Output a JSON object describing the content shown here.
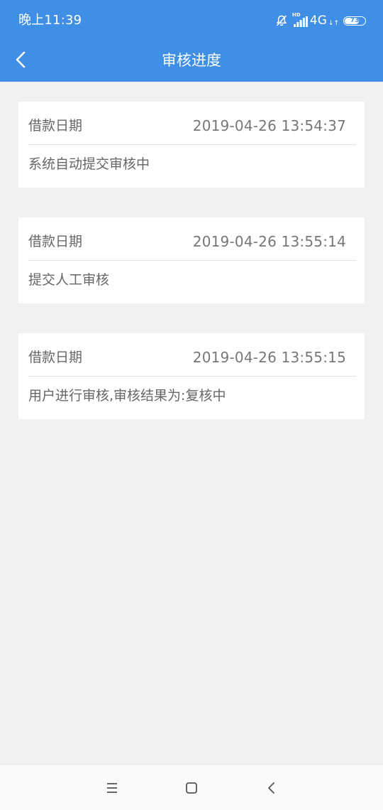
{
  "status_bar": {
    "time": "晚上11:39",
    "hd_label": "HD",
    "network_type": "4G",
    "network_arrows": "↓↑",
    "battery_level": "73",
    "battery_fraction": 0.73,
    "icons": [
      "bell-off-icon",
      "signal-icon",
      "battery-icon"
    ]
  },
  "header": {
    "title": "审核进度",
    "back_icon": "chevron-left-icon",
    "background_color": "#3f8fe6"
  },
  "records": [
    {
      "label": "借款日期",
      "datetime": "2019-04-26 13:54:37",
      "status": "系统自动提交审核中"
    },
    {
      "label": "借款日期",
      "datetime": "2019-04-26 13:55:14",
      "status": "提交人工审核"
    },
    {
      "label": "借款日期",
      "datetime": "2019-04-26 13:55:15",
      "status": "用户进行审核,审核结果为:复核中"
    }
  ],
  "system_nav": {
    "buttons": [
      "menu-icon",
      "home-icon",
      "back-icon"
    ]
  }
}
